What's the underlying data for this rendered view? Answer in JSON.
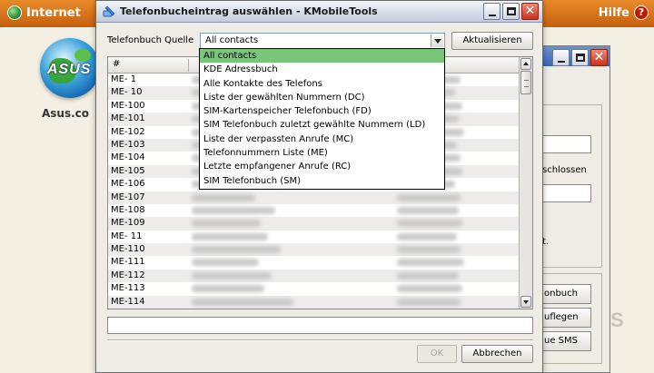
{
  "background_app": {
    "internet_label": "Internet",
    "help_label": "Hilfe",
    "help_symbol": "?",
    "logo_text": "ASUS",
    "site_label": "Asus.co",
    "watermark": "S",
    "dialog2": {
      "label_closed": "schlossen",
      "label_dot": "t.",
      "buttons": [
        "onbuch",
        "uflegen",
        "ue SMS"
      ]
    }
  },
  "dialog": {
    "title": "Telefonbucheintrag auswählen - KMobileTools",
    "source_label": "Telefonbuch Quelle",
    "source_value": "All contacts",
    "refresh_label": "Aktualisieren",
    "columns": {
      "id": "#"
    },
    "rows": [
      "ME- 1",
      "ME- 10",
      "ME-100",
      "ME-101",
      "ME-102",
      "ME-103",
      "ME-104",
      "ME-105",
      "ME-106",
      "ME-107",
      "ME-108",
      "ME-109",
      "ME- 11",
      "ME-110",
      "ME-111",
      "ME-112",
      "ME-113",
      "ME-114"
    ],
    "dropdown_options": [
      "All contacts",
      "KDE Adressbuch",
      "Alle Kontakte des Telefons",
      "Liste der gewählten Nummern (DC)",
      "SIM-Kartenspeicher Telefonbuch (FD)",
      "SIM Telefonbuch zuletzt gewählte Nummern (LD)",
      "Liste der verpassten Anrufe (MC)",
      "Telefonnummern Liste (ME)",
      "Letzte empfangener Anrufe (RC)",
      "SIM Telefonbuch (SM)"
    ],
    "search_value": "",
    "ok_label": "OK",
    "cancel_label": "Abbrechen"
  },
  "colors": {
    "topbar": "#d8741b",
    "selected_option": "#79c57a",
    "dialog_bg": "#efebe5"
  },
  "icons": [
    "globe-icon",
    "help-icon",
    "kmobiletools-icon",
    "minimize-icon",
    "maximize-icon",
    "close-icon",
    "dropdown-arrow-icon",
    "scroll-up-icon",
    "scroll-down-icon"
  ]
}
